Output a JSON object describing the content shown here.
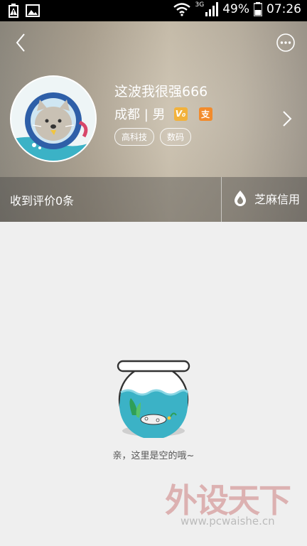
{
  "status_bar": {
    "network_type": "3G",
    "battery": "49%",
    "time": "07:26"
  },
  "header": {
    "username": "这波我很强666",
    "location_gender": "成都 | 男",
    "badge_v": "V₀",
    "badge_zhi": "支",
    "tags": [
      "高科技",
      "数码"
    ],
    "reviews_text": "收到评价0条",
    "sesame_credit": "芝麻信用"
  },
  "empty_state": {
    "message": "亲，这里是空的哦~"
  },
  "watermark": {
    "title": "外设天下",
    "url": "www.pcwaishe.cn"
  },
  "colors": {
    "status_bar_bg": "#000000",
    "page_bg": "#efefef",
    "badge_v": "#f2b23c",
    "badge_zhi": "#f28b2c"
  }
}
